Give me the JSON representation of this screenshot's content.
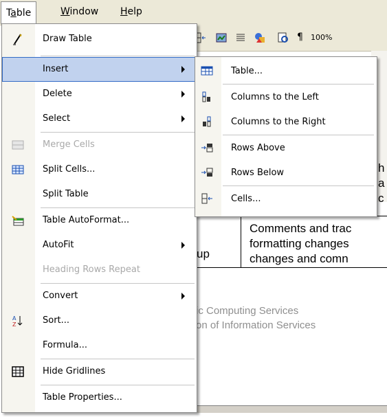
{
  "menubar": {
    "items": [
      {
        "label": "Table",
        "active": true
      },
      {
        "label": "Window"
      },
      {
        "label": "Help"
      }
    ]
  },
  "toolbar": {
    "zoom": "100%"
  },
  "document": {
    "cell_left": "up",
    "cell_right_lines": [
      "Comments and trac",
      "formatting changes",
      "changes and comn"
    ],
    "partial_lines": [
      "h",
      "a",
      "c"
    ],
    "footer_lines": [
      "ic Computing Services",
      "on of Information Services"
    ]
  },
  "table_menu": {
    "items": [
      {
        "label": "Draw Table",
        "icon": "pencil-icon"
      },
      {
        "label": "Insert",
        "submenu": true,
        "highlighted": true
      },
      {
        "label": "Delete",
        "submenu": true
      },
      {
        "label": "Select",
        "submenu": true
      },
      {
        "label": "Merge Cells",
        "disabled": true,
        "icon": "merge-cells-icon"
      },
      {
        "label": "Split Cells...",
        "icon": "split-cells-icon"
      },
      {
        "label": "Split Table"
      },
      {
        "label": "Table AutoFormat...",
        "icon": "autoformat-icon"
      },
      {
        "label": "AutoFit",
        "submenu": true
      },
      {
        "label": "Heading Rows Repeat",
        "disabled": true
      },
      {
        "label": "Convert",
        "submenu": true
      },
      {
        "label": "Sort...",
        "icon": "sort-az-icon"
      },
      {
        "label": "Formula..."
      },
      {
        "label": "Hide Gridlines",
        "icon": "gridlines-icon"
      },
      {
        "label": "Table Properties..."
      }
    ]
  },
  "insert_submenu": {
    "items": [
      {
        "label": "Table...",
        "icon": "insert-table-icon"
      },
      {
        "label": "Columns to the Left",
        "icon": "columns-left-icon"
      },
      {
        "label": "Columns to the Right",
        "icon": "columns-right-icon"
      },
      {
        "label": "Rows Above",
        "icon": "rows-above-icon"
      },
      {
        "label": "Rows Below",
        "icon": "rows-below-icon"
      },
      {
        "label": "Cells...",
        "icon": "insert-cells-icon"
      }
    ]
  },
  "colors": {
    "menu_highlight": "#c1d2ee",
    "menu_highlight_border": "#316ac5",
    "disabled_text": "#a9a9a9",
    "chrome": "#ece9d8"
  }
}
